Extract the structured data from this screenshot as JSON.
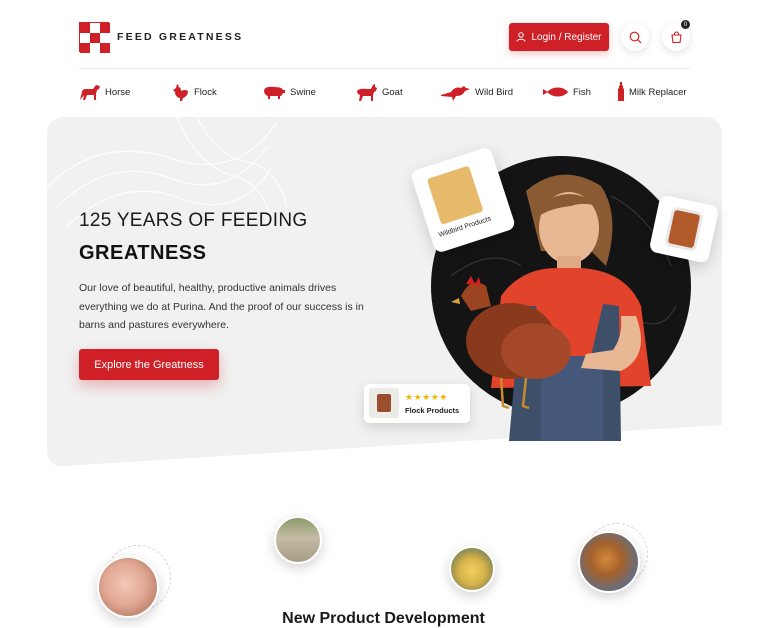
{
  "brand": {
    "name": "FEED GREATNESS",
    "accent": "#d02027"
  },
  "header": {
    "login_label": "Login / Register",
    "login_icon": "user-icon",
    "search_icon": "search-icon",
    "cart_icon": "cart-icon",
    "cart_count": "0"
  },
  "categories": [
    {
      "label": "Horse",
      "icon": "horse-icon"
    },
    {
      "label": "Flock",
      "icon": "chicken-icon"
    },
    {
      "label": "Swine",
      "icon": "pig-icon"
    },
    {
      "label": "Goat",
      "icon": "goat-icon"
    },
    {
      "label": "Wild Bird",
      "icon": "bird-icon"
    },
    {
      "label": "Fish",
      "icon": "fish-icon"
    },
    {
      "label": "Milk Replacer",
      "icon": "bottle-icon"
    }
  ],
  "hero": {
    "title_line1": "125 YEARS OF FEEDING",
    "title_line2": "GREATNESS",
    "body": "Our love of beautiful, healthy, productive animals drives everything we do at Purina. And the proof of our success is in barns and pastures everywhere.",
    "cta_label": "Explore the Greatness",
    "card_wildbird_label": "Wildbird Products",
    "card_flock_label": "Flock Products",
    "card_flock_stars": "★★★★★"
  },
  "section": {
    "title": "New Product Development"
  }
}
